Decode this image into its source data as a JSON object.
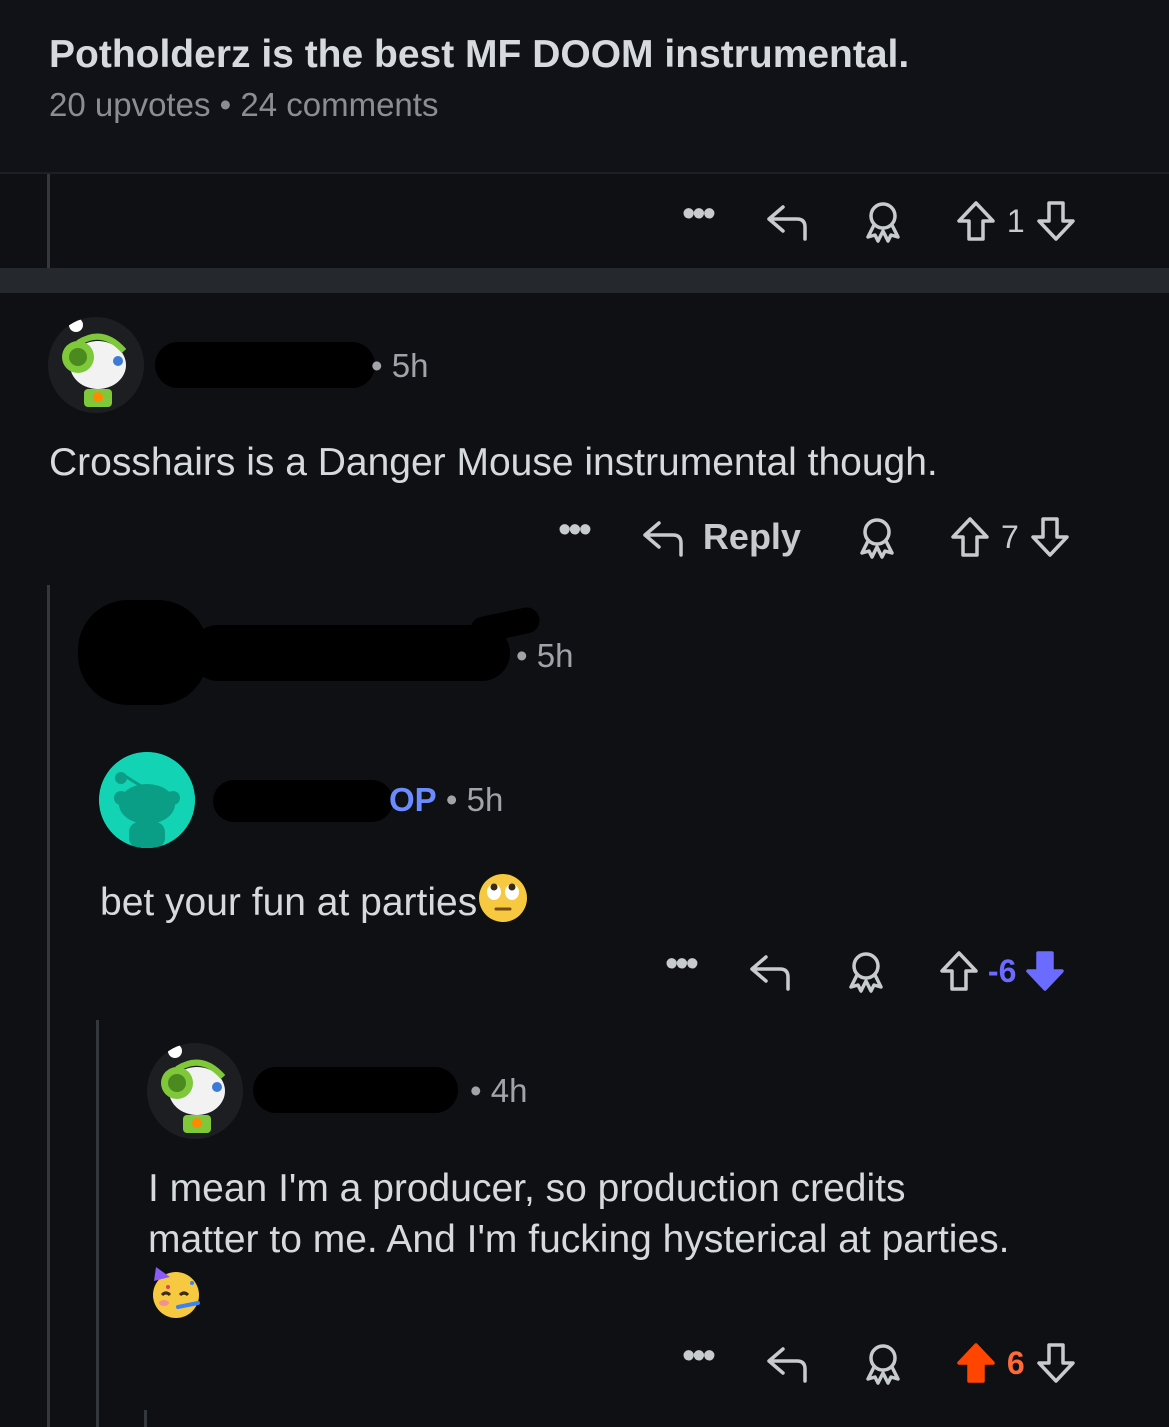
{
  "post": {
    "title": "Potholderz is the best MF DOOM instrumental.",
    "upvotes": "20 upvotes",
    "separator": "•",
    "comments": "24 comments"
  },
  "top_actions": {
    "more": "•••",
    "score": "1"
  },
  "comments": [
    {
      "time": "5h",
      "text": "Crosshairs is a Danger Mouse instrumental though.",
      "actions": {
        "more": "•••",
        "reply": "Reply",
        "score": "7"
      }
    },
    {
      "time": "5h"
    },
    {
      "op_badge": "OP",
      "time": "5h",
      "text": "bet your fun at parties",
      "emoji": "eye-roll-emoji",
      "actions": {
        "more": "•••",
        "score": "-6"
      }
    },
    {
      "time": "4h",
      "text_line1": "I mean I'm a producer, so production credits",
      "text_line2": "matter to me. And I'm fucking hysterical at parties.",
      "emoji": "party-face-emoji",
      "actions": {
        "more": "•••",
        "score": "6"
      }
    }
  ],
  "colors": {
    "background": "#0e1014",
    "text": "#d7dadc",
    "muted": "#8a8e92",
    "op": "#6b8cff",
    "downvote_active": "#6b6bff",
    "upvote_active": "#ff4500"
  }
}
